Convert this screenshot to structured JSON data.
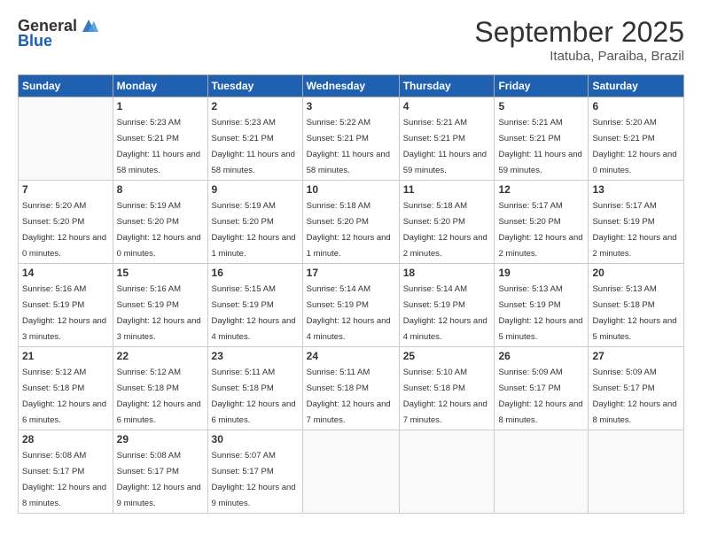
{
  "logo": {
    "general": "General",
    "blue": "Blue"
  },
  "header": {
    "month": "September 2025",
    "location": "Itatuba, Paraiba, Brazil"
  },
  "weekdays": [
    "Sunday",
    "Monday",
    "Tuesday",
    "Wednesday",
    "Thursday",
    "Friday",
    "Saturday"
  ],
  "days": [
    {
      "date": null,
      "num": null,
      "sunrise": null,
      "sunset": null,
      "daylight": null
    },
    {
      "date": "1",
      "num": "1",
      "sunrise": "Sunrise: 5:23 AM",
      "sunset": "Sunset: 5:21 PM",
      "daylight": "Daylight: 11 hours and 58 minutes."
    },
    {
      "date": "2",
      "num": "2",
      "sunrise": "Sunrise: 5:23 AM",
      "sunset": "Sunset: 5:21 PM",
      "daylight": "Daylight: 11 hours and 58 minutes."
    },
    {
      "date": "3",
      "num": "3",
      "sunrise": "Sunrise: 5:22 AM",
      "sunset": "Sunset: 5:21 PM",
      "daylight": "Daylight: 11 hours and 58 minutes."
    },
    {
      "date": "4",
      "num": "4",
      "sunrise": "Sunrise: 5:21 AM",
      "sunset": "Sunset: 5:21 PM",
      "daylight": "Daylight: 11 hours and 59 minutes."
    },
    {
      "date": "5",
      "num": "5",
      "sunrise": "Sunrise: 5:21 AM",
      "sunset": "Sunset: 5:21 PM",
      "daylight": "Daylight: 11 hours and 59 minutes."
    },
    {
      "date": "6",
      "num": "6",
      "sunrise": "Sunrise: 5:20 AM",
      "sunset": "Sunset: 5:21 PM",
      "daylight": "Daylight: 12 hours and 0 minutes."
    },
    {
      "date": "7",
      "num": "7",
      "sunrise": "Sunrise: 5:20 AM",
      "sunset": "Sunset: 5:20 PM",
      "daylight": "Daylight: 12 hours and 0 minutes."
    },
    {
      "date": "8",
      "num": "8",
      "sunrise": "Sunrise: 5:19 AM",
      "sunset": "Sunset: 5:20 PM",
      "daylight": "Daylight: 12 hours and 0 minutes."
    },
    {
      "date": "9",
      "num": "9",
      "sunrise": "Sunrise: 5:19 AM",
      "sunset": "Sunset: 5:20 PM",
      "daylight": "Daylight: 12 hours and 1 minute."
    },
    {
      "date": "10",
      "num": "10",
      "sunrise": "Sunrise: 5:18 AM",
      "sunset": "Sunset: 5:20 PM",
      "daylight": "Daylight: 12 hours and 1 minute."
    },
    {
      "date": "11",
      "num": "11",
      "sunrise": "Sunrise: 5:18 AM",
      "sunset": "Sunset: 5:20 PM",
      "daylight": "Daylight: 12 hours and 2 minutes."
    },
    {
      "date": "12",
      "num": "12",
      "sunrise": "Sunrise: 5:17 AM",
      "sunset": "Sunset: 5:20 PM",
      "daylight": "Daylight: 12 hours and 2 minutes."
    },
    {
      "date": "13",
      "num": "13",
      "sunrise": "Sunrise: 5:17 AM",
      "sunset": "Sunset: 5:19 PM",
      "daylight": "Daylight: 12 hours and 2 minutes."
    },
    {
      "date": "14",
      "num": "14",
      "sunrise": "Sunrise: 5:16 AM",
      "sunset": "Sunset: 5:19 PM",
      "daylight": "Daylight: 12 hours and 3 minutes."
    },
    {
      "date": "15",
      "num": "15",
      "sunrise": "Sunrise: 5:16 AM",
      "sunset": "Sunset: 5:19 PM",
      "daylight": "Daylight: 12 hours and 3 minutes."
    },
    {
      "date": "16",
      "num": "16",
      "sunrise": "Sunrise: 5:15 AM",
      "sunset": "Sunset: 5:19 PM",
      "daylight": "Daylight: 12 hours and 4 minutes."
    },
    {
      "date": "17",
      "num": "17",
      "sunrise": "Sunrise: 5:14 AM",
      "sunset": "Sunset: 5:19 PM",
      "daylight": "Daylight: 12 hours and 4 minutes."
    },
    {
      "date": "18",
      "num": "18",
      "sunrise": "Sunrise: 5:14 AM",
      "sunset": "Sunset: 5:19 PM",
      "daylight": "Daylight: 12 hours and 4 minutes."
    },
    {
      "date": "19",
      "num": "19",
      "sunrise": "Sunrise: 5:13 AM",
      "sunset": "Sunset: 5:19 PM",
      "daylight": "Daylight: 12 hours and 5 minutes."
    },
    {
      "date": "20",
      "num": "20",
      "sunrise": "Sunrise: 5:13 AM",
      "sunset": "Sunset: 5:18 PM",
      "daylight": "Daylight: 12 hours and 5 minutes."
    },
    {
      "date": "21",
      "num": "21",
      "sunrise": "Sunrise: 5:12 AM",
      "sunset": "Sunset: 5:18 PM",
      "daylight": "Daylight: 12 hours and 6 minutes."
    },
    {
      "date": "22",
      "num": "22",
      "sunrise": "Sunrise: 5:12 AM",
      "sunset": "Sunset: 5:18 PM",
      "daylight": "Daylight: 12 hours and 6 minutes."
    },
    {
      "date": "23",
      "num": "23",
      "sunrise": "Sunrise: 5:11 AM",
      "sunset": "Sunset: 5:18 PM",
      "daylight": "Daylight: 12 hours and 6 minutes."
    },
    {
      "date": "24",
      "num": "24",
      "sunrise": "Sunrise: 5:11 AM",
      "sunset": "Sunset: 5:18 PM",
      "daylight": "Daylight: 12 hours and 7 minutes."
    },
    {
      "date": "25",
      "num": "25",
      "sunrise": "Sunrise: 5:10 AM",
      "sunset": "Sunset: 5:18 PM",
      "daylight": "Daylight: 12 hours and 7 minutes."
    },
    {
      "date": "26",
      "num": "26",
      "sunrise": "Sunrise: 5:09 AM",
      "sunset": "Sunset: 5:17 PM",
      "daylight": "Daylight: 12 hours and 8 minutes."
    },
    {
      "date": "27",
      "num": "27",
      "sunrise": "Sunrise: 5:09 AM",
      "sunset": "Sunset: 5:17 PM",
      "daylight": "Daylight: 12 hours and 8 minutes."
    },
    {
      "date": "28",
      "num": "28",
      "sunrise": "Sunrise: 5:08 AM",
      "sunset": "Sunset: 5:17 PM",
      "daylight": "Daylight: 12 hours and 8 minutes."
    },
    {
      "date": "29",
      "num": "29",
      "sunrise": "Sunrise: 5:08 AM",
      "sunset": "Sunset: 5:17 PM",
      "daylight": "Daylight: 12 hours and 9 minutes."
    },
    {
      "date": "30",
      "num": "30",
      "sunrise": "Sunrise: 5:07 AM",
      "sunset": "Sunset: 5:17 PM",
      "daylight": "Daylight: 12 hours and 9 minutes."
    }
  ]
}
